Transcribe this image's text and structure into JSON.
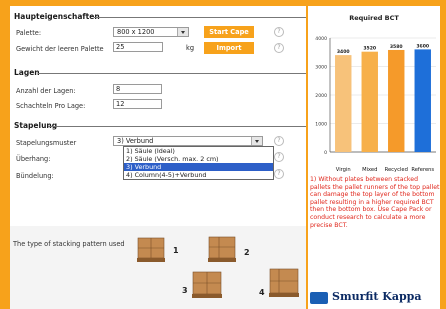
{
  "sections": {
    "main": "Haupteigenschaften",
    "layers": "Lagen",
    "stacking": "Stapelung"
  },
  "fields": {
    "pallet_label": "Palette:",
    "pallet_value": "800 x 1200",
    "empty_weight_label": "Gewicht der leeren Palette",
    "empty_weight_value": "25",
    "empty_weight_unit": "kg",
    "layer_count_label": "Anzahl der Lagen:",
    "layer_count_value": "8",
    "boxes_per_layer_label": "Schachteln Pro Lage:",
    "boxes_per_layer_value": "12",
    "pattern_label": "Stapelungsmuster",
    "pattern_value": "3) Verbund",
    "overhang_label": "Überhang:",
    "bundling_label": "Bündelung:"
  },
  "dropdown_options": [
    "1) Säule (Ideal)",
    "2) Säule (Versch. max. 2 cm)",
    "3) Verbund",
    "4) Column(4-5)+Verbund"
  ],
  "dropdown_selected_index": 2,
  "buttons": {
    "start": "Start Cape",
    "import": "Import"
  },
  "help_glyph": "?",
  "bottom_caption": "The type of stacking pattern used",
  "pattern_numbers": [
    "1",
    "2",
    "3",
    "4"
  ],
  "chart_data": {
    "type": "bar",
    "title": "Required BCT",
    "categories": [
      "Virgin",
      "Mixed",
      "Recycled",
      "Reference"
    ],
    "category_labels": [
      "Virgin",
      "Mixed",
      "Recycled",
      "Referens"
    ],
    "values": [
      3400,
      3520,
      3580,
      3600
    ],
    "value_labels": [
      "3400",
      "3520",
      "3580",
      "3600"
    ],
    "ylim": [
      0,
      4000
    ],
    "yticks": [
      0,
      1000,
      2000,
      3000,
      4000
    ],
    "colors": [
      "#f7c27a",
      "#f7b04a",
      "#f59a2a",
      "#1e6fd9"
    ]
  },
  "note": "1) Without plates between stacked pallets the pallet runners of the top pallet can damage the top layer of the bottom pallet resulting in a higher required BCT then the bottom box. Use Cape Pack or conduct research to calculate a more precise BCT.",
  "logo_text": "Smurfit Kappa",
  "colors": {
    "accent": "#f7a21b",
    "selection": "#2d5fc8",
    "note": "#e0261b",
    "brand": "#0b2a63"
  }
}
